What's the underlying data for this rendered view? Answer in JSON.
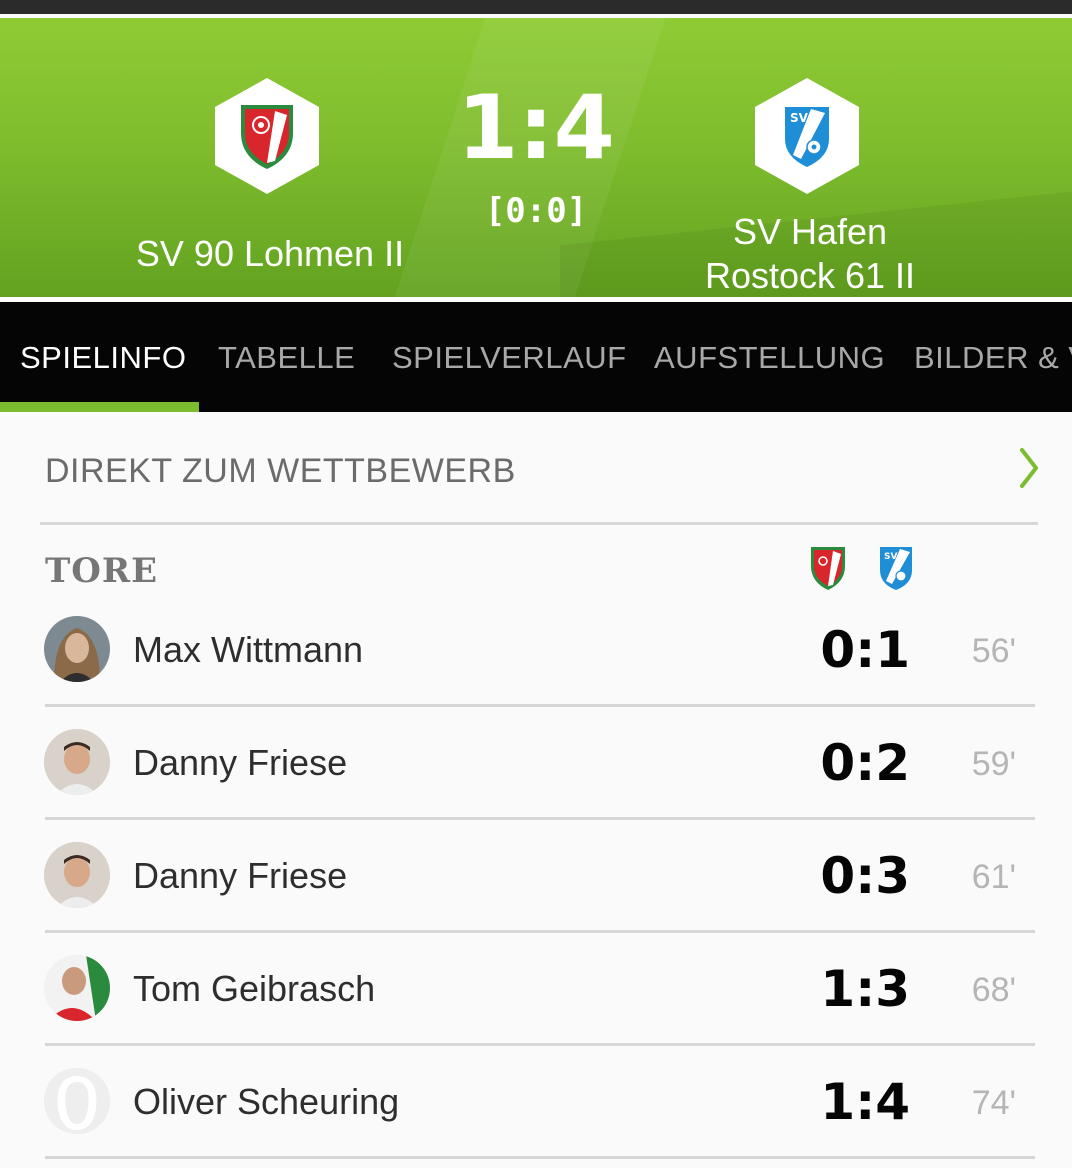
{
  "match": {
    "home_team": "SV 90 Lohmen II",
    "away_team_line1": "SV Hafen",
    "away_team_line2": "Rostock 61 II",
    "score": "1:4",
    "halftime": "[0:0]"
  },
  "tabs": [
    {
      "label": "SPIELINFO",
      "active": true
    },
    {
      "label": "TABELLE",
      "active": false
    },
    {
      "label": "SPIELVERLAUF",
      "active": false
    },
    {
      "label": "AUFSTELLUNG",
      "active": false
    },
    {
      "label": "BILDER & V",
      "active": false
    }
  ],
  "competition_link": {
    "label": "DIREKT ZUM WETTBEWERB",
    "icon": "chevron-right-icon"
  },
  "goals_section": {
    "title": "TORE",
    "goals": [
      {
        "player": "Max Wittmann",
        "score": "0:1",
        "minute": "56'"
      },
      {
        "player": "Danny Friese",
        "score": "0:2",
        "minute": "59'"
      },
      {
        "player": "Danny Friese",
        "score": "0:3",
        "minute": "61'"
      },
      {
        "player": "Tom Geibrasch",
        "score": "1:3",
        "minute": "68'"
      },
      {
        "player": "Oliver Scheuring",
        "score": "1:4",
        "minute": "74'"
      }
    ]
  },
  "colors": {
    "accent_green": "#7bbd2e",
    "home_red": "#d9262c",
    "home_green": "#2a8a3e",
    "away_blue": "#1e8fd6"
  }
}
